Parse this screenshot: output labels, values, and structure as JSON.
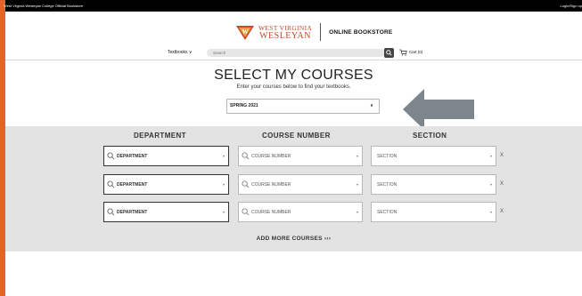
{
  "topbar": {
    "left_text": "West Virginia Wesleyan College Official Bookstore",
    "right_text": "Login/Sign up"
  },
  "header": {
    "logo_line1": "WEST VIRGINIA",
    "logo_line2": "WESLEYAN",
    "store_label": "ONLINE BOOKSTORE"
  },
  "nav": {
    "textbooks_label": "Textbooks ∨",
    "search_placeholder": "Search",
    "cart_label": "Cart (0)"
  },
  "main": {
    "title": "SELECT MY COURSES",
    "subtitle": "Enter your courses below to find your textbooks.",
    "term_value": "SPRING 2021"
  },
  "courses": {
    "headers": {
      "department": "DEPARTMENT",
      "course_number": "COURSE NUMBER",
      "section": "SECTION"
    },
    "rows": [
      {
        "department": "DEPARTMENT",
        "course_number": "COURSE NUMBER",
        "section": "SECTION",
        "remove": "X"
      },
      {
        "department": "DEPARTMENT",
        "course_number": "COURSE NUMBER",
        "section": "SECTION",
        "remove": "X"
      },
      {
        "department": "DEPARTMENT",
        "course_number": "COURSE NUMBER",
        "section": "SECTION",
        "remove": "X"
      }
    ],
    "add_more_label": "ADD MORE COURSES ›››"
  },
  "colors": {
    "border_accent": "#e8612c",
    "brand_red": "#c8472a",
    "panel_gray": "#e3e3e3",
    "arrow_gray": "#7d868c"
  },
  "icons": {
    "logo": "wvwc-seal-icon",
    "search": "magnifier-icon",
    "cart": "cart-icon",
    "callout": "left-arrow-icon"
  }
}
